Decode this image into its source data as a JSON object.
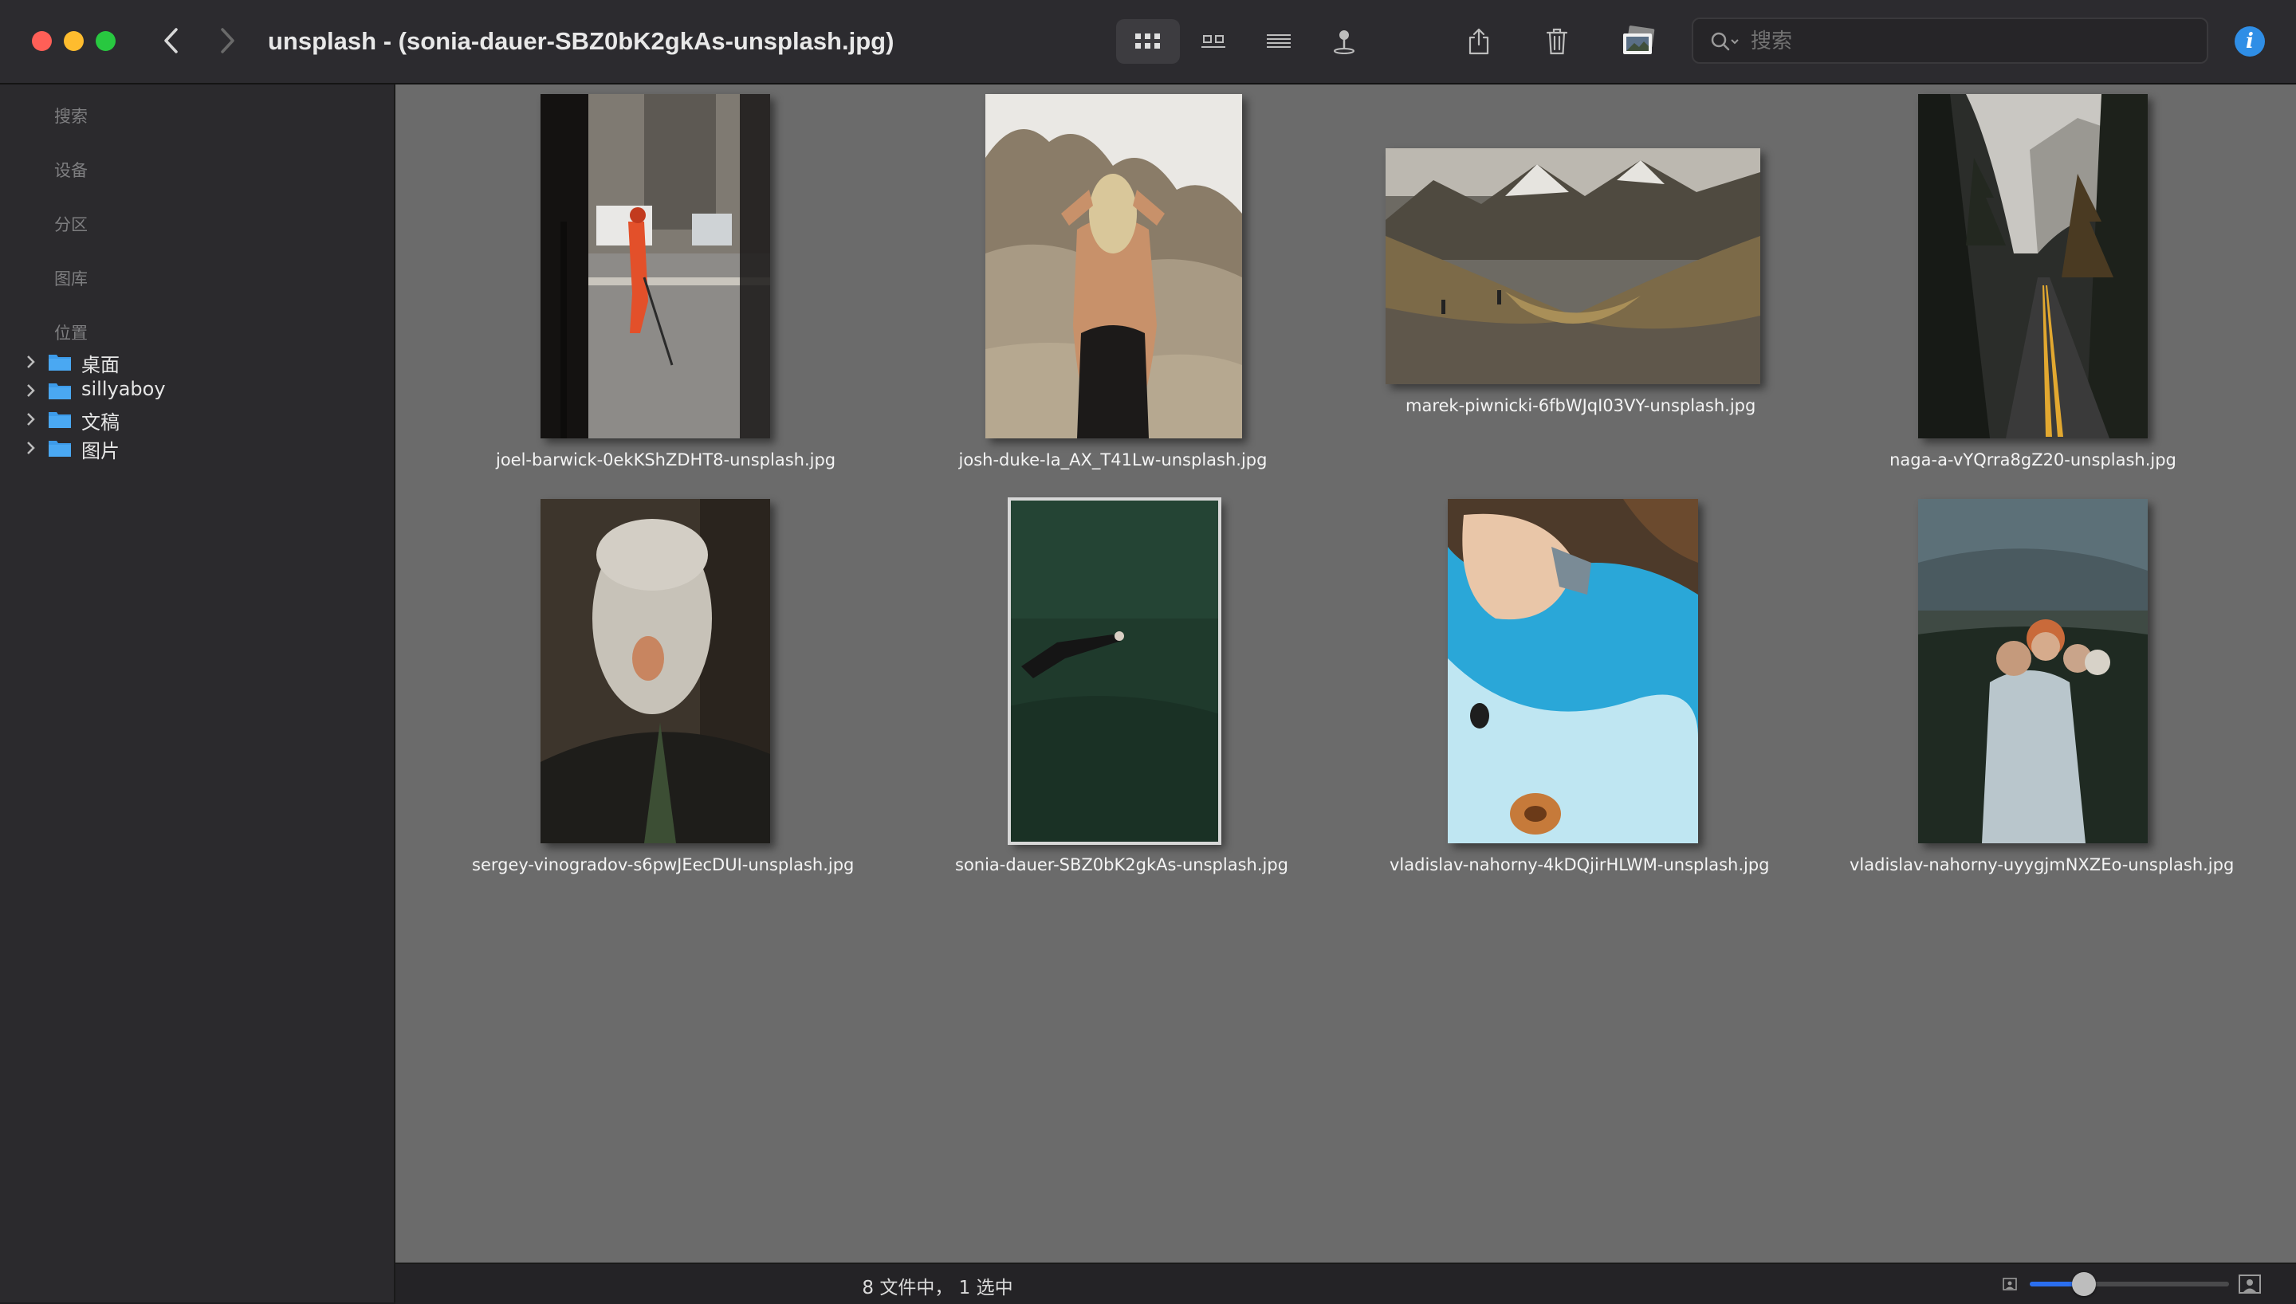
{
  "window": {
    "title": "unsplash - (sonia-dauer-SBZ0bK2gkAs-unsplash.jpg)"
  },
  "toolbar": {
    "view_modes": [
      "grid-view-icon",
      "filmstrip-view-icon",
      "list-view-icon",
      "map-view-icon"
    ],
    "active_view": "grid-view-icon",
    "actions": [
      "share-icon",
      "trash-icon",
      "photos-icon"
    ],
    "search": {
      "placeholder": "搜索",
      "value": ""
    },
    "info_label": "i"
  },
  "sidebar": {
    "sections": [
      "搜索",
      "设备",
      "分区",
      "图库",
      "位置"
    ],
    "locations": [
      {
        "label": "桌面",
        "icon": "folder-icon"
      },
      {
        "label": "sillyaboy",
        "icon": "folder-icon"
      },
      {
        "label": "文稿",
        "icon": "folder-icon"
      },
      {
        "label": "图片",
        "icon": "folder-icon"
      }
    ]
  },
  "files": [
    {
      "name": "joel-barwick-0ekKShZDHT8-unsplash.jpg",
      "selected": false
    },
    {
      "name": "josh-duke-Ia_AX_T41Lw-unsplash.jpg",
      "selected": false
    },
    {
      "name": "marek-piwnicki-6fbWJqI03VY-unsplash.jpg",
      "selected": false
    },
    {
      "name": "naga-a-vYQrra8gZ20-unsplash.jpg",
      "selected": false
    },
    {
      "name": "sergey-vinogradov-s6pwJEecDUI-unsplash.jpg",
      "selected": false
    },
    {
      "name": "sonia-dauer-SBZ0bK2gkAs-unsplash.jpg",
      "selected": true
    },
    {
      "name": "vladislav-nahorny-4kDQjirHLWM-unsplash.jpg",
      "selected": false
    },
    {
      "name": "vladislav-nahorny-uyygjmNXZEo-unsplash.jpg",
      "selected": false
    }
  ],
  "status": {
    "text": "8 文件中， 1 选中",
    "zoom_fraction": 0.27
  },
  "colors": {
    "accent": "#2b6ff0",
    "content_bg": "#6b6b6b",
    "folder": "#3d9be9"
  }
}
